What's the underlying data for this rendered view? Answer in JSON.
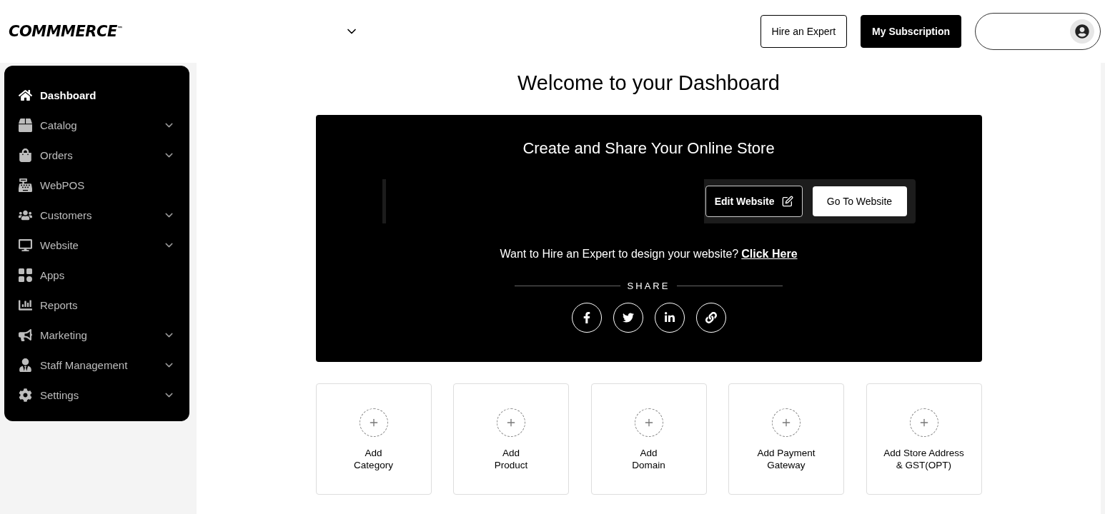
{
  "header": {
    "logo": "COMMMERCE$^{™}$",
    "buttons": [
      {
        "label": "Hire an Expert",
        "kind": "outline"
      },
      {
        "label": "My Subscription",
        "kind": "filled"
      }
    ]
  },
  "sidebar": {
    "items": [
      {
        "label": "Dashboard",
        "selected": true,
        "expandable": false
      },
      {
        "label": "Catalog",
        "selected": false,
        "expandable": true
      },
      {
        "label": "Orders",
        "selected": false,
        "expandable": true
      },
      {
        "label": "WebPOS",
        "selected": false,
        "expandable": false
      },
      {
        "label": "Customers",
        "selected": false,
        "expandable": true
      },
      {
        "label": "Website",
        "selected": false,
        "expandable": true
      },
      {
        "label": "Apps",
        "selected": false,
        "expandable": false
      },
      {
        "label": "Reports",
        "selected": false,
        "expandable": false
      },
      {
        "label": "Marketing",
        "selected": false,
        "expandable": true
      },
      {
        "label": "Staff Management",
        "selected": false,
        "expandable": true
      },
      {
        "label": "Settings",
        "selected": false,
        "expandable": true
      }
    ]
  },
  "main": {
    "title": "Welcome to your Dashboard",
    "store_card": {
      "title": "Create and Share Your Online Store",
      "edit_button": "Edit Website",
      "go_button": "Go To Website",
      "hire_text": "Want to Hire an Expert to design your website?",
      "hire_link": "Click Here",
      "share_label": "SHARE"
    },
    "quick_actions": [
      {
        "line1": "Add",
        "line2": "Category"
      },
      {
        "line1": "Add",
        "line2": "Product"
      },
      {
        "line1": "Add",
        "line2": "Domain"
      },
      {
        "line1": "Add Payment",
        "line2": "Gateway"
      },
      {
        "line1": "Add Store Address",
        "line2": "& GST(OPT)"
      }
    ]
  }
}
